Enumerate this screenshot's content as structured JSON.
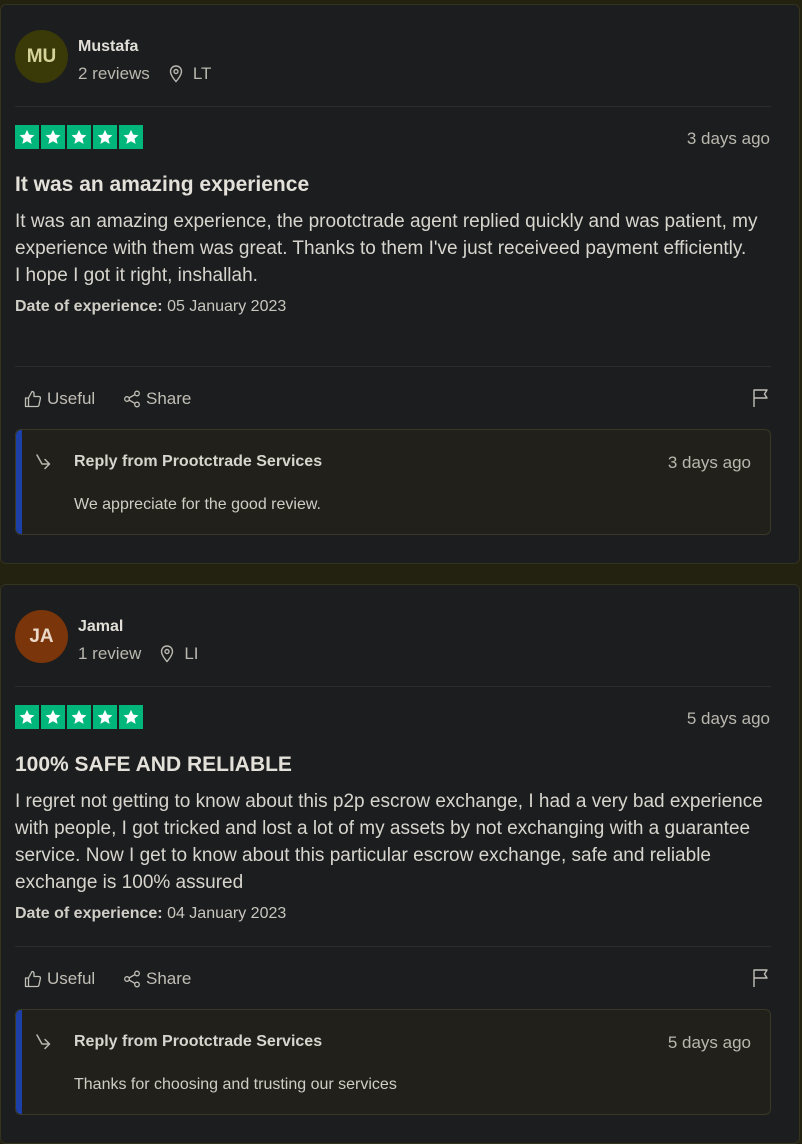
{
  "colors": {
    "page_bg": "#23210f",
    "card_bg": "#1c1d1f",
    "star_green": "#00b67a",
    "reply_accent": "#1c3fa8"
  },
  "reviews": [
    {
      "avatar_initials": "MU",
      "avatar_bg": "#3a3a08",
      "avatar_fg": "#d6d39a",
      "name": "Mustafa",
      "review_count": "2 reviews",
      "country": "LT",
      "rating": 5,
      "date": "3 days ago",
      "title": "It was an amazing experience",
      "body": "It was an amazing experience, the prootctrade agent replied quickly and was patient, my experience with them was great. Thanks to them I've just receiveed payment efficiently.\nI hope I got it right, inshallah.",
      "exp_label": "Date of experience:",
      "exp_date": "05 January 2023",
      "useful_label": "Useful",
      "share_label": "Share",
      "reply_from": "Reply from Prootctrade Services",
      "reply_date": "3 days ago",
      "reply_text": "We appreciate for the good review."
    },
    {
      "avatar_initials": "JA",
      "avatar_bg": "#7a350a",
      "avatar_fg": "#ead9c8",
      "name": "Jamal",
      "review_count": "1 review",
      "country": "LI",
      "rating": 5,
      "date": "5 days ago",
      "title": "100% SAFE AND RELIABLE",
      "body": "I regret not getting to know about this p2p escrow exchange, I had a very bad experience with people, I got tricked and lost a lot of my assets by not exchanging with a guarantee service. Now I get to know about this particular escrow exchange, safe and reliable exchange is 100% assured",
      "exp_label": "Date of experience:",
      "exp_date": "04 January 2023",
      "useful_label": "Useful",
      "share_label": "Share",
      "reply_from": "Reply from Prootctrade Services",
      "reply_date": "5 days ago",
      "reply_text": "Thanks for choosing and trusting our services"
    }
  ]
}
